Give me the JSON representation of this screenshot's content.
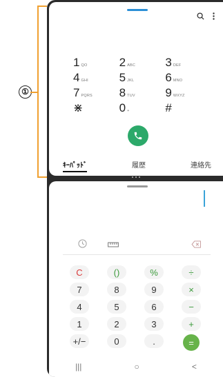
{
  "annotation": {
    "callout": "①"
  },
  "dialer": {
    "keys": [
      [
        {
          "digit": "1",
          "letters": "QO"
        },
        {
          "digit": "2",
          "letters": "ABC"
        },
        {
          "digit": "3",
          "letters": "DEF"
        }
      ],
      [
        {
          "digit": "4",
          "letters": "GHI"
        },
        {
          "digit": "5",
          "letters": "JKL"
        },
        {
          "digit": "6",
          "letters": "MNO"
        }
      ],
      [
        {
          "digit": "7",
          "letters": "PQRS"
        },
        {
          "digit": "8",
          "letters": "TUV"
        },
        {
          "digit": "9",
          "letters": "WXYZ"
        }
      ],
      [
        {
          "digit": "⋇",
          "letters": ""
        },
        {
          "digit": "0",
          "letters": "+"
        },
        {
          "digit": "#",
          "letters": ""
        }
      ]
    ],
    "tabs": [
      {
        "label": "ｷｰﾊﾟｯﾄﾞ",
        "active": true
      },
      {
        "label": "履歴",
        "active": false
      },
      {
        "label": "連絡先",
        "active": false
      }
    ]
  },
  "calculator": {
    "rows": [
      [
        {
          "label": "C",
          "style": "red"
        },
        {
          "label": "()",
          "style": "green"
        },
        {
          "label": "%",
          "style": "green"
        },
        {
          "label": "÷",
          "style": "green"
        }
      ],
      [
        {
          "label": "7",
          "style": ""
        },
        {
          "label": "8",
          "style": ""
        },
        {
          "label": "9",
          "style": ""
        },
        {
          "label": "×",
          "style": "green"
        }
      ],
      [
        {
          "label": "4",
          "style": ""
        },
        {
          "label": "5",
          "style": ""
        },
        {
          "label": "6",
          "style": ""
        },
        {
          "label": "−",
          "style": "green"
        }
      ],
      [
        {
          "label": "1",
          "style": ""
        },
        {
          "label": "2",
          "style": ""
        },
        {
          "label": "3",
          "style": ""
        },
        {
          "label": "+",
          "style": "green"
        }
      ],
      [
        {
          "label": "+/−",
          "style": ""
        },
        {
          "label": "0",
          "style": ""
        },
        {
          "label": ".",
          "style": ""
        },
        {
          "label": "=",
          "style": "equals"
        }
      ]
    ]
  },
  "nav": {
    "recent": "|||",
    "home": "○",
    "back": "<"
  },
  "colors": {
    "accent": "#2b8fd6",
    "call": "#2ca96a",
    "equals": "#67b34a",
    "bracket": "#f0a030"
  }
}
